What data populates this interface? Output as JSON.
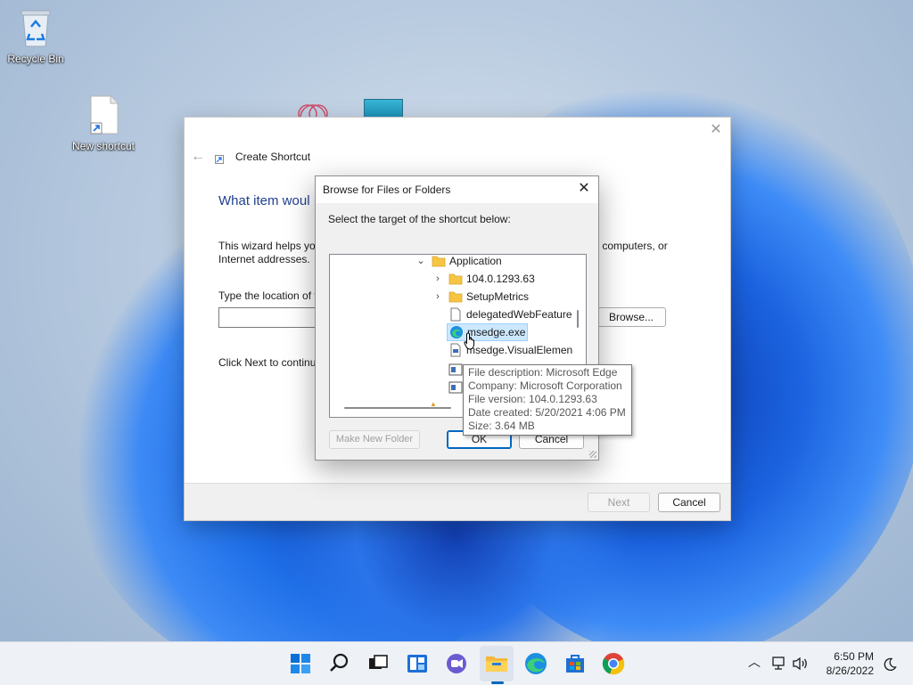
{
  "desktop": {
    "icons": [
      {
        "label": "Recycle Bin",
        "icon": "recycle-bin-icon"
      },
      {
        "label": "New shortcut",
        "icon": "shortcut-file-icon"
      }
    ]
  },
  "wizard": {
    "title": "Create Shortcut",
    "heading": "What item woul",
    "description": "This wizard helps you",
    "description_right": "ers, computers, or",
    "description_line2": "Internet addresses.",
    "location_label": "Type the location of t",
    "location_value": "",
    "browse_button": "Browse...",
    "continue_text": "Click Next to continu",
    "next_button": "Next",
    "cancel_button": "Cancel",
    "close_icon": "close-icon",
    "back_icon": "back-arrow-icon"
  },
  "browse_dialog": {
    "title": "Browse for Files or Folders",
    "instruction": "Select the target of the shortcut below:",
    "tree": [
      {
        "label": "Application",
        "icon": "folder-icon",
        "expander": "expanded"
      },
      {
        "label": "104.0.1293.63",
        "icon": "folder-icon",
        "expander": "collapsed"
      },
      {
        "label": "SetupMetrics",
        "icon": "folder-icon",
        "expander": "collapsed"
      },
      {
        "label": "delegatedWebFeature",
        "icon": "file-icon",
        "expander": "none"
      },
      {
        "label": "msedge.exe",
        "icon": "edge-icon",
        "expander": "none",
        "selected": true
      },
      {
        "label": "msedge.VisualElemen",
        "icon": "xml-file-icon",
        "expander": "none"
      }
    ],
    "make_folder_button": "Make New Folder",
    "ok_button": "OK",
    "cancel_button": "Cancel"
  },
  "tooltip": {
    "description": "File description: Microsoft Edge",
    "company": "Company: Microsoft Corporation",
    "version": "File version: 104.0.1293.63",
    "created": "Date created: 5/20/2021 4:06 PM",
    "size": "Size: 3.64 MB"
  },
  "taskbar": {
    "apps": [
      "start-icon",
      "search-icon",
      "task-view-icon",
      "widgets-icon",
      "chat-icon",
      "file-explorer-icon",
      "edge-icon",
      "store-icon",
      "chrome-icon"
    ],
    "time": "6:50 PM",
    "date": "8/26/2022"
  },
  "colors": {
    "accent": "#0067c0",
    "heading": "#1f3f8f",
    "selection": "#cce8ff"
  }
}
